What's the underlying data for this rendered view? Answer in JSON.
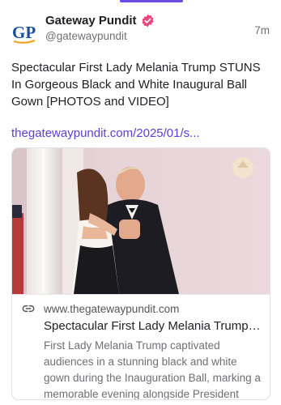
{
  "author": {
    "display_name": "Gateway Pundit",
    "handle": "@gatewaypundit",
    "avatar_text": "GP"
  },
  "post": {
    "time": "7m",
    "text": "Spectacular First Lady Melania Trump STUNS In Gorgeous Black and White Inaugural Ball Gown [PHOTOS and VIDEO]",
    "link": "thegatewaypundit.com/2025/01/s..."
  },
  "card": {
    "domain": "www.thegatewaypundit.com",
    "title": "Spectacular First Lady Melania Trump STUNS In Gorgeous Black and White Inaugural Ball Gown",
    "description": "First Lady Melania Trump captivated audiences in a stunning black and white gown during the Inauguration Ball, marking a memorable evening alongside President Trump."
  },
  "colors": {
    "accent": "#6b4de6",
    "link": "#5b3fd6",
    "verified": "#e8467c",
    "avatar_blue": "#1a4f9c",
    "avatar_orange": "#f0a21a"
  },
  "icons": {
    "avatar": "gateway-pundit-logo",
    "verified": "verified-badge-icon",
    "link": "link-chain-icon"
  }
}
